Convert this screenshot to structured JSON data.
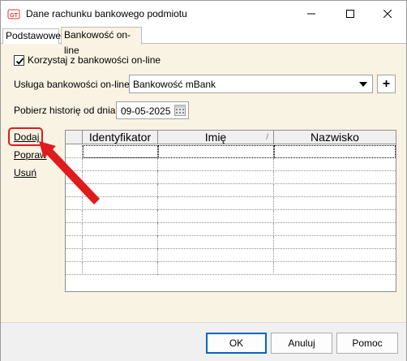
{
  "window": {
    "title": "Dane rachunku bankowego podmiotu",
    "icon": "app-logo-icon"
  },
  "tabs": [
    {
      "label": "Podstawowe",
      "active": false
    },
    {
      "label": "Bankowość on-line",
      "active": true
    }
  ],
  "form": {
    "use_online_banking_label": "Korzystaj z bankowości on-line",
    "use_online_banking_checked": true,
    "service_label": "Usługa bankowości on-line:",
    "service_value": "Bankowość mBank",
    "add_service_label": "+",
    "history_label": "Pobierz historię od dnia:",
    "history_date": "09-05-2025"
  },
  "side_actions": {
    "add": "Dodaj",
    "edit": "Popraw",
    "delete": "Usuń"
  },
  "grid": {
    "columns": [
      "",
      "Identyfikator",
      "Imię",
      "Nazwisko"
    ],
    "sort_mark": "/",
    "row_count": 10
  },
  "footer": {
    "ok": "OK",
    "cancel": "Anuluj",
    "help": "Pomoc"
  },
  "colors": {
    "panel_bg": "#f9f3e3",
    "annotation_red": "#e01b1b",
    "focus_blue": "#0067c0"
  }
}
